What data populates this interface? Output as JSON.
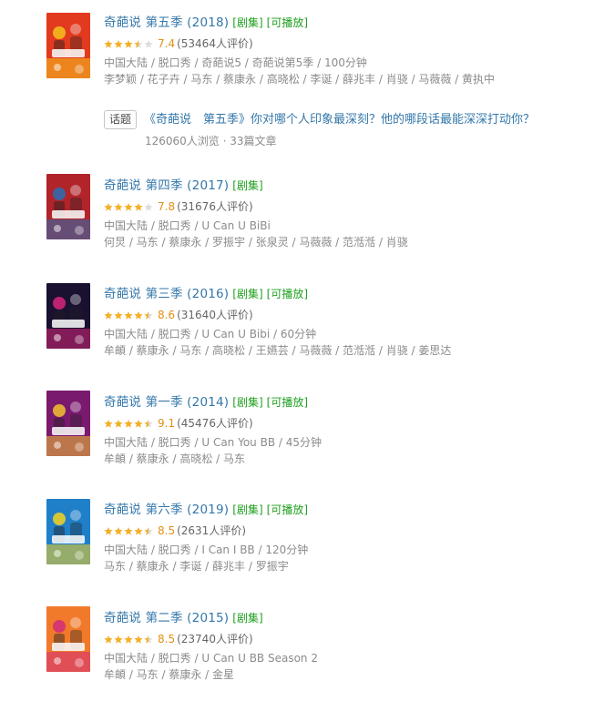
{
  "results": [
    {
      "title": "奇葩说 第五季 (2018)",
      "tags": [
        "[剧集]",
        "[可播放]"
      ],
      "stars": 3.5,
      "score": "7.4",
      "votes": "(53464人评价)",
      "meta1": "中国大陆 / 脱口秀 / 奇葩说5 / 奇葩说第5季 / 100分钟",
      "meta2": "李梦颖 / 花子卉 / 马东 / 蔡康永 / 高晓松 / 李诞 / 薛兆丰 / 肖骁 / 马薇薇 / 黄执中",
      "poster": {
        "bg": "#e23a1f",
        "accent": "#f4c21c",
        "text": "奇葩说5"
      }
    },
    {
      "title": "奇葩说 第四季 (2017)",
      "tags": [
        "[剧集]"
      ],
      "stars": 4,
      "score": "7.8",
      "votes": "(31676人评价)",
      "meta1": "中国大陆 / 脱口秀 / U Can U BiBi",
      "meta2": "何炅 / 马东 / 蔡康永 / 罗振宇 / 张泉灵 / 马薇薇 / 范湉湉 / 肖骁",
      "poster": {
        "bg": "#b0242a",
        "accent": "#2a6fb3",
        "text": ""
      }
    },
    {
      "title": "奇葩说 第三季 (2016)",
      "tags": [
        "[剧集]",
        "[可播放]"
      ],
      "stars": 4.5,
      "score": "8.6",
      "votes": "(31640人评价)",
      "meta1": "中国大陆 / 脱口秀 / U Can U Bibi / 60分钟",
      "meta2": "牟頔 / 蔡康永 / 马东 / 高晓松 / 王嬿芸 / 马薇薇 / 范湉湉 / 肖骁 / 姜思达",
      "poster": {
        "bg": "#1a1030",
        "accent": "#d8267a",
        "text": "奇葩说"
      }
    },
    {
      "title": "奇葩说 第一季 (2014)",
      "tags": [
        "[剧集]",
        "[可播放]"
      ],
      "stars": 4.5,
      "score": "9.1",
      "votes": "(45476人评价)",
      "meta1": "中国大陆 / 脱口秀 / U Can You BB / 45分钟",
      "meta2": "牟頔 / 蔡康永 / 高晓松 / 马东",
      "poster": {
        "bg": "#7a1a6e",
        "accent": "#f2c230",
        "text": ""
      }
    },
    {
      "title": "奇葩说 第六季 (2019)",
      "tags": [
        "[剧集]",
        "[可播放]"
      ],
      "stars": 4.5,
      "score": "8.5",
      "votes": "(2631人评价)",
      "meta1": "中国大陆 / 脱口秀 / I Can I BB / 120分钟",
      "meta2": "马东 / 蔡康永 / 李诞 / 薛兆丰 / 罗振宇",
      "poster": {
        "bg": "#1f7fc8",
        "accent": "#f6d21e",
        "text": "奇葩说"
      }
    },
    {
      "title": "奇葩说 第二季 (2015)",
      "tags": [
        "[剧集]"
      ],
      "stars": 4.5,
      "score": "8.5",
      "votes": "(23740人评价)",
      "meta1": "中国大陆 / 脱口秀 / U Can U BB Season 2",
      "meta2": "牟頔 / 马东 / 蔡康永 / 金星",
      "poster": {
        "bg": "#f07a2a",
        "accent": "#d42a7a",
        "text": ""
      }
    }
  ],
  "topic": {
    "badge": "话题",
    "title": "《奇葩说　第五季》你对哪个人印象最深刻？他的哪段话最能深深打动你？",
    "stats": "126060人浏览 · 33篇文章"
  },
  "colors": {
    "link": "#3377aa",
    "tag": "#1fa01f",
    "score": "#e09015",
    "meta": "#8b8b8b",
    "star_full": "#f5b026",
    "star_empty": "#dddddd"
  }
}
